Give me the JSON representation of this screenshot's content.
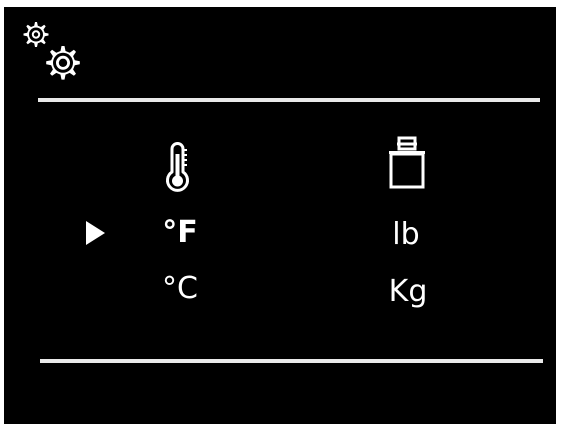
{
  "header": {
    "icon": "settings-gears-icon"
  },
  "temperature": {
    "icon": "thermometer-icon",
    "options": [
      "°F",
      "°C"
    ],
    "selected": "°F"
  },
  "weight": {
    "icon": "weight-icon",
    "options": [
      "lb",
      "Kg"
    ]
  },
  "selection_cursor": {
    "icon": "triangle-right-icon",
    "row": 0
  },
  "colors": {
    "background": "#000000",
    "foreground": "#ffffff",
    "divider": "#e9e9e9"
  }
}
